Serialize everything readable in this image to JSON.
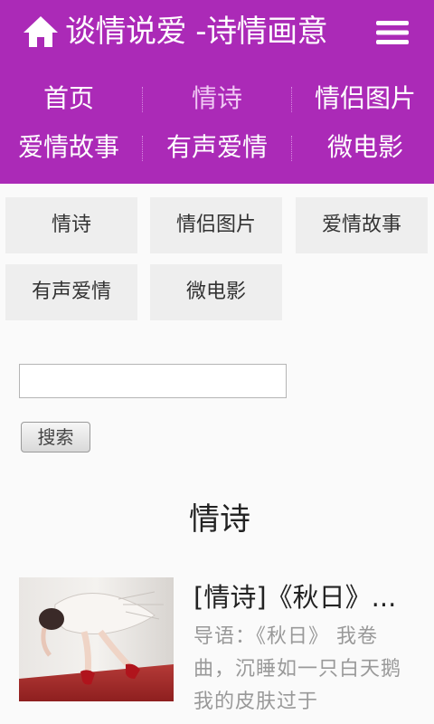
{
  "header": {
    "site_title": "谈情说爱 -诗情画意",
    "home_icon": "home-icon",
    "menu_icon": "menu-icon",
    "background_color": "#ab2ab7"
  },
  "nav": {
    "row1": [
      "首页",
      "情诗",
      "情侣图片"
    ],
    "row2": [
      "爱情故事",
      "有声爱情",
      "微电影"
    ],
    "active": "情诗"
  },
  "categories": [
    "情诗",
    "情侣图片",
    "爱情故事",
    "有声爱情",
    "微电影"
  ],
  "search": {
    "value": "",
    "placeholder": "",
    "button_label": "搜索"
  },
  "section": {
    "title": "情诗"
  },
  "article": {
    "title": "[情诗]《秋日》...",
    "excerpt": "导语：《秋日》 我卷曲，沉睡如一只白天鹅 我的皮肤过于"
  }
}
